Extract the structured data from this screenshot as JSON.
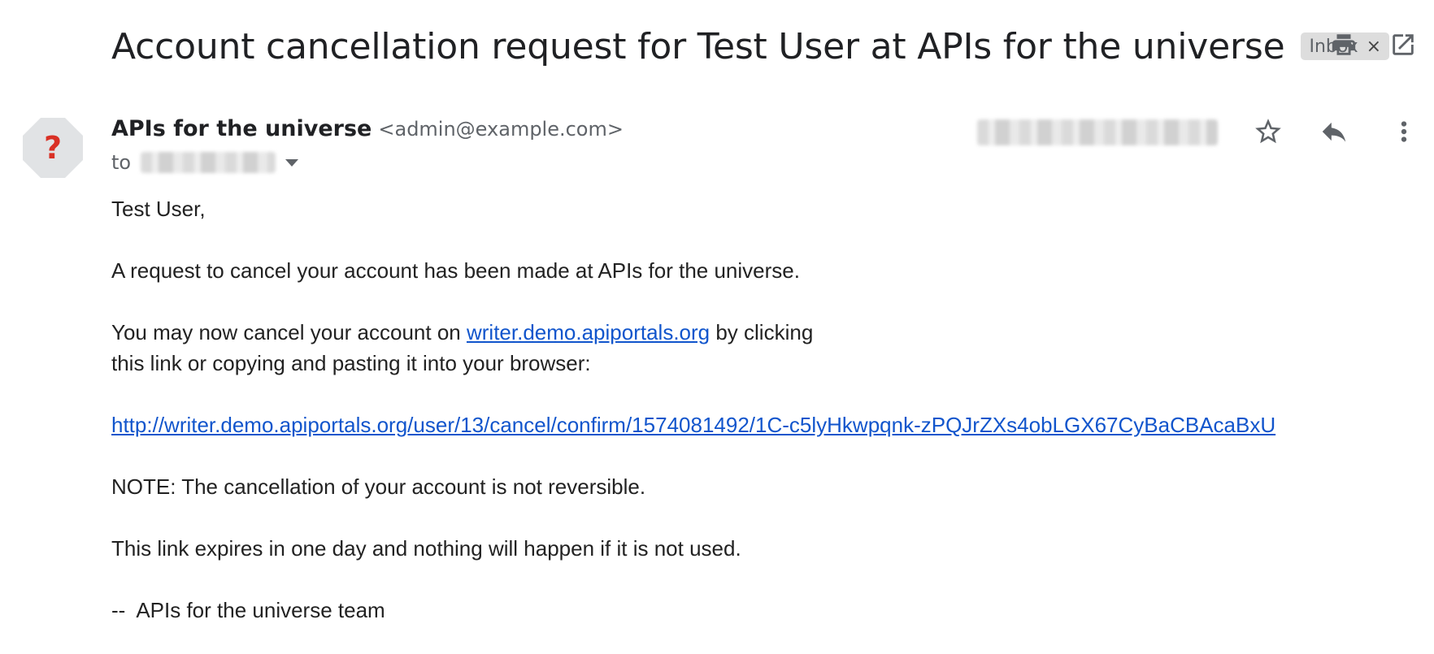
{
  "header": {
    "subject": "Account cancellation request for Test User at APIs for the universe",
    "label": "Inbox",
    "label_close": "×",
    "print_icon": "print-icon",
    "open_in_new_window_icon": "open-in-new-icon"
  },
  "message": {
    "avatar_icon": "unknown-sender-icon",
    "avatar_glyph": "?",
    "sender_name": "APIs for the universe",
    "sender_email": "<admin@example.com>",
    "to_prefix": "to",
    "star_icon": "star-icon",
    "reply_icon": "reply-icon",
    "more_icon": "more-vert-icon"
  },
  "body": {
    "greeting": "Test User,",
    "line1": "A request to cancel your account has been made at APIs for the universe.",
    "line2_pre": "You may now cancel your account on ",
    "line2_link": "writer.demo.apiportals.org",
    "line2_post": " by clicking",
    "line3": "this link or copying and pasting it into your browser:",
    "cancel_link": "http://writer.demo.apiportals.org/user/13/cancel/confirm/1574081492/1C-c5lyHkwpqnk-zPQJrZXs4obLGX67CyBaCBAcaBxU",
    "note": "NOTE: The cancellation of your account is not reversible.",
    "expiry": "This link expires in one day and nothing will happen if it is not used.",
    "signature": "--  APIs for the universe team"
  },
  "colors": {
    "link": "#1155cc",
    "avatar_bg": "#e1e3e5",
    "avatar_glyph": "#d93025",
    "label_bg": "#dddddd"
  }
}
